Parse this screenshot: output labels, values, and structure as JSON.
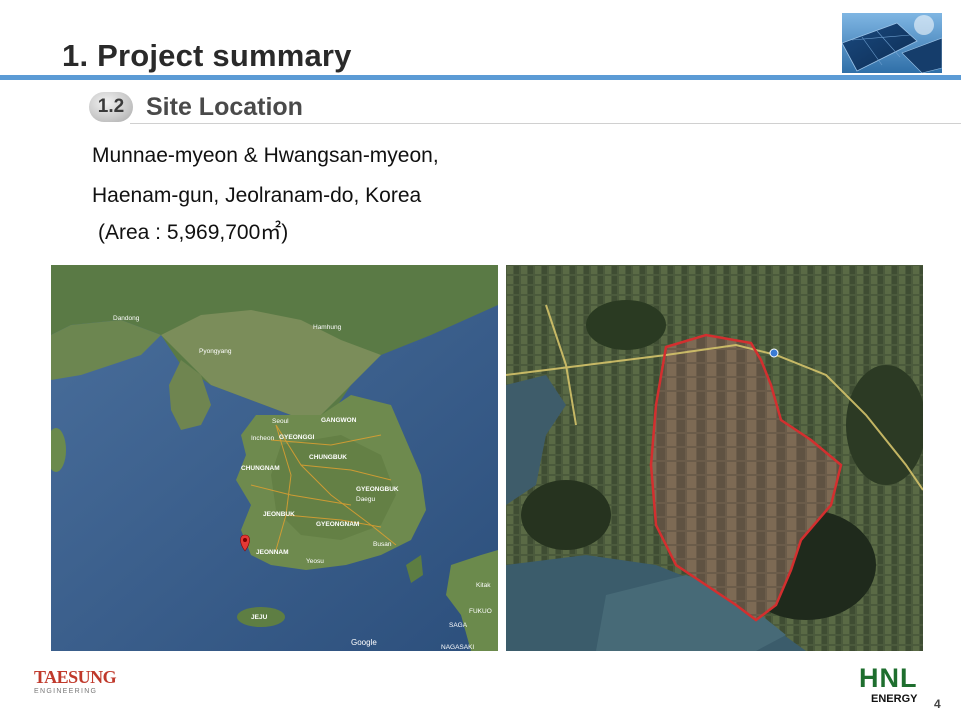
{
  "header": {
    "title": "1. Project summary",
    "accent_color": "#5b9bd5"
  },
  "section": {
    "number": "1.2",
    "title": "Site Location"
  },
  "location": {
    "line1": "Munnae-myeon & Hwangsan-myeon,",
    "line2": "Haenam-gun, Jeolranam-do, Korea",
    "area_prefix": "(Area : 5,969,700㎡)"
  },
  "map_left": {
    "labels": [
      "Dandong",
      "Pyongyang",
      "Hamhung",
      "Seoul",
      "Incheon",
      "GYEONGGI",
      "GANGWON",
      "CHUNGBUK",
      "CHUNGNAM",
      "GYEONGBUK",
      "Daegu",
      "JEONBUK",
      "GYEONGNAM",
      "Busan",
      "JEONNAM",
      "Yeosu",
      "JEJU",
      "Google",
      "Kitak",
      "FUKUO",
      "SAGA",
      "NAGASAKI"
    ],
    "marker": "map-pin-icon"
  },
  "map_right": {
    "boundary_color": "#d32f2f"
  },
  "footer": {
    "left_logo": "TAESUNG",
    "left_logo_sub": "ENGINEERING",
    "right_logo": "HNL",
    "right_logo_sub": "ENERGY",
    "page_number": "4"
  }
}
